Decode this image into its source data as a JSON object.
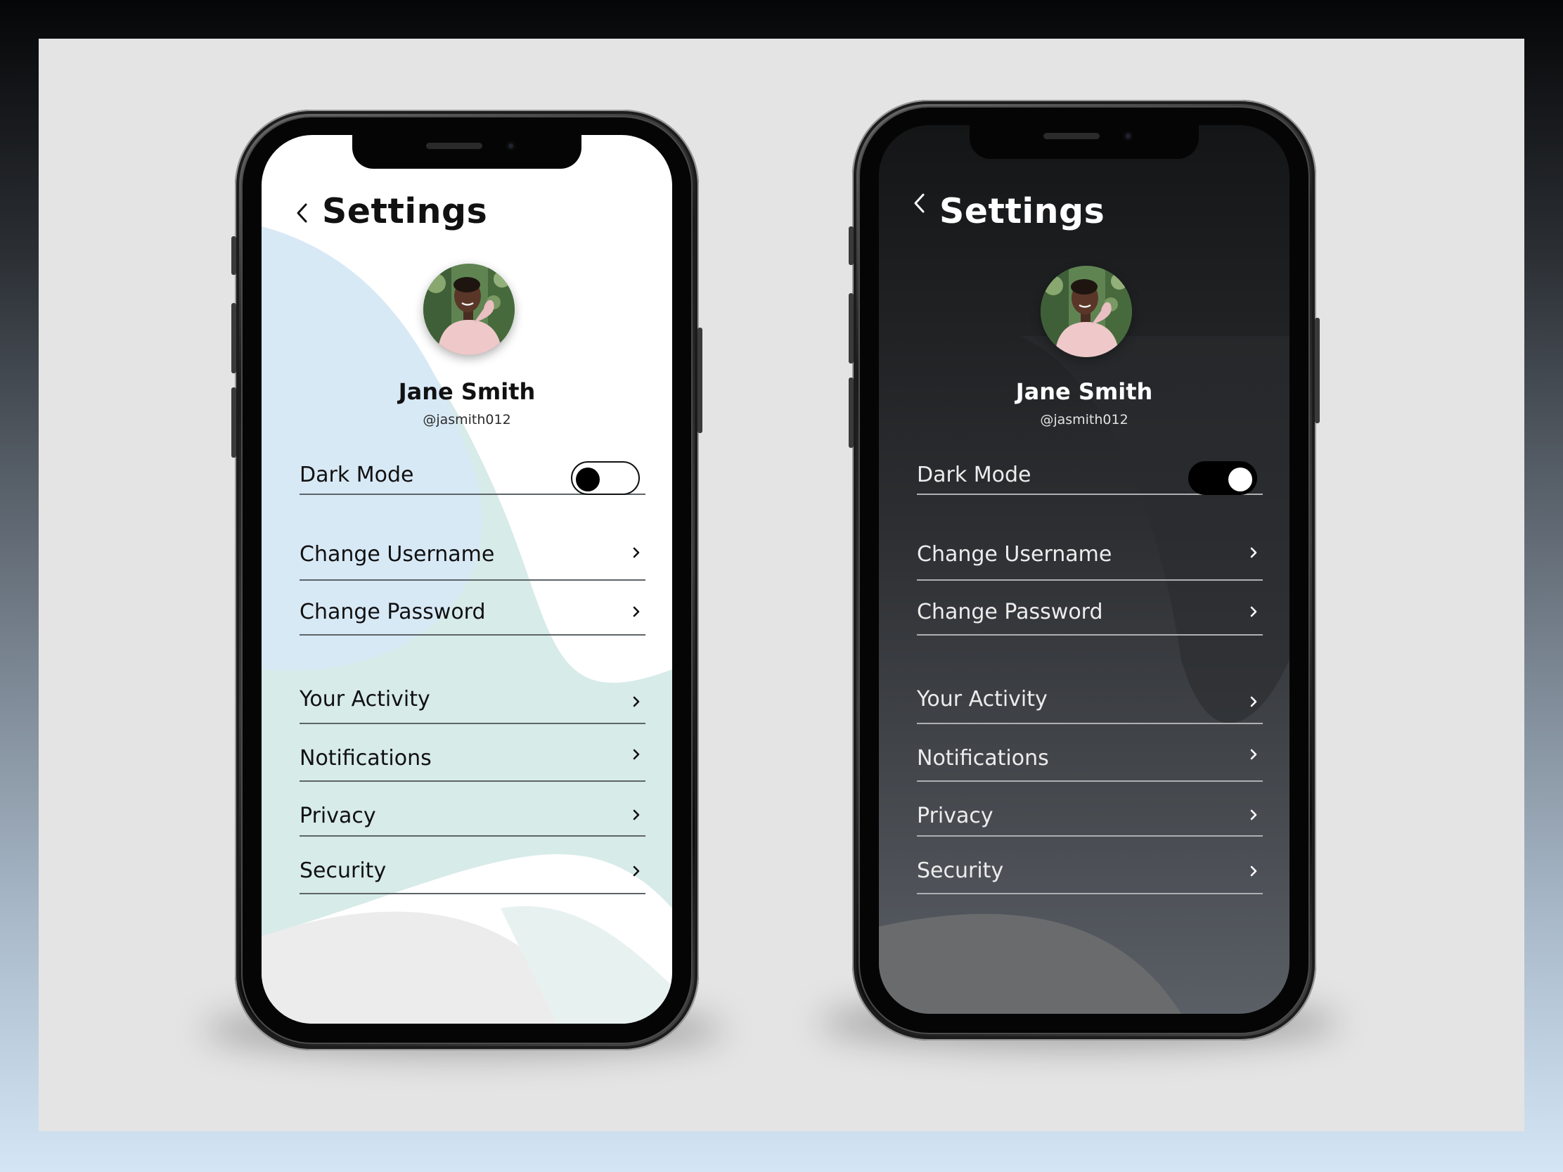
{
  "screens": [
    {
      "mode": "light",
      "title": "Settings",
      "back_icon": "chevron-left-icon",
      "profile": {
        "name": "Jane Smith",
        "handle": "@jasmith012"
      },
      "dark_mode": {
        "label": "Dark Mode",
        "enabled": false
      },
      "menu_items": [
        {
          "label": "Change Username",
          "icon": "chevron-right-icon"
        },
        {
          "label": "Change Password",
          "icon": "chevron-right-icon"
        },
        {
          "label": "Your Activity",
          "icon": "chevron-right-icon"
        },
        {
          "label": "Notifications",
          "icon": "chevron-right-icon"
        },
        {
          "label": "Privacy",
          "icon": "chevron-right-icon"
        },
        {
          "label": "Security",
          "icon": "chevron-right-icon"
        }
      ]
    },
    {
      "mode": "dark",
      "title": "Settings",
      "back_icon": "chevron-left-icon",
      "profile": {
        "name": "Jane Smith",
        "handle": "@jasmith012"
      },
      "dark_mode": {
        "label": "Dark Mode",
        "enabled": true
      },
      "menu_items": [
        {
          "label": "Change Username",
          "icon": "chevron-right-icon"
        },
        {
          "label": "Change Password",
          "icon": "chevron-right-icon"
        },
        {
          "label": "Your Activity",
          "icon": "chevron-right-icon"
        },
        {
          "label": "Notifications",
          "icon": "chevron-right-icon"
        },
        {
          "label": "Privacy",
          "icon": "chevron-right-icon"
        },
        {
          "label": "Security",
          "icon": "chevron-right-icon"
        }
      ]
    }
  ],
  "colors": {
    "stage_background": "#e4e4e4",
    "light_screen": "#ffffff",
    "dark_screen": "#191a1c",
    "light_blob_blue": "#d8e9f6",
    "light_blob_teal": "#d7ebe9",
    "dark_blob": "#4b4c50",
    "text_dark": "#111111",
    "text_light": "#ffffff",
    "divider_light": "#5d6468",
    "divider_dark": "#aeb0b2"
  }
}
